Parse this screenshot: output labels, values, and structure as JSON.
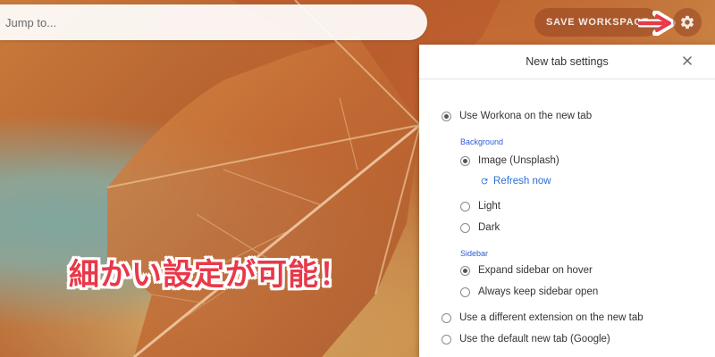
{
  "jump_bar": {
    "placeholder": "Jump to..."
  },
  "toolbar": {
    "save_workspace_label": "SAVE WORKSPACE",
    "settings_icon": "gear-icon"
  },
  "annotation": {
    "arrow_icon": "red-arrow-icon",
    "arrow_color": "#e8394a",
    "caption": "細かい設定が可能！"
  },
  "settings_panel": {
    "title": "New tab settings",
    "close_icon": "close-icon",
    "use_workona": {
      "label": "Use Workona on the new tab",
      "selected": true
    },
    "background": {
      "section_label": "Background",
      "options": [
        {
          "label": "Image (Unsplash)",
          "selected": true
        },
        {
          "label": "Light",
          "selected": false
        },
        {
          "label": "Dark",
          "selected": false
        }
      ],
      "refresh_label": "Refresh now",
      "refresh_icon": "refresh-icon"
    },
    "sidebar": {
      "section_label": "Sidebar",
      "options": [
        {
          "label": "Expand sidebar on hover",
          "selected": true
        },
        {
          "label": "Always keep sidebar open",
          "selected": false
        }
      ]
    },
    "different_extension": {
      "label": "Use a different extension on the new tab",
      "selected": false
    },
    "default_tab": {
      "label": "Use the default new tab (Google)",
      "selected": false
    }
  },
  "colors": {
    "link": "#2a6fd6",
    "section_label": "#2a5bd7"
  }
}
